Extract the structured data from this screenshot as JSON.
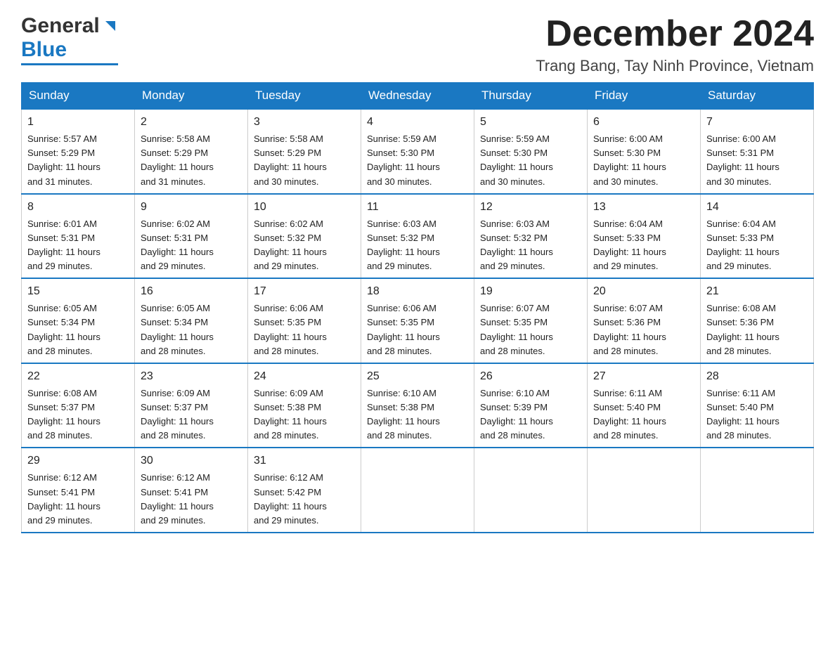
{
  "logo": {
    "general": "General",
    "blue": "Blue"
  },
  "title": "December 2024",
  "location": "Trang Bang, Tay Ninh Province, Vietnam",
  "days_of_week": [
    "Sunday",
    "Monday",
    "Tuesday",
    "Wednesday",
    "Thursday",
    "Friday",
    "Saturday"
  ],
  "weeks": [
    [
      {
        "day": "1",
        "sunrise": "5:57 AM",
        "sunset": "5:29 PM",
        "daylight": "11 hours and 31 minutes."
      },
      {
        "day": "2",
        "sunrise": "5:58 AM",
        "sunset": "5:29 PM",
        "daylight": "11 hours and 31 minutes."
      },
      {
        "day": "3",
        "sunrise": "5:58 AM",
        "sunset": "5:29 PM",
        "daylight": "11 hours and 30 minutes."
      },
      {
        "day": "4",
        "sunrise": "5:59 AM",
        "sunset": "5:30 PM",
        "daylight": "11 hours and 30 minutes."
      },
      {
        "day": "5",
        "sunrise": "5:59 AM",
        "sunset": "5:30 PM",
        "daylight": "11 hours and 30 minutes."
      },
      {
        "day": "6",
        "sunrise": "6:00 AM",
        "sunset": "5:30 PM",
        "daylight": "11 hours and 30 minutes."
      },
      {
        "day": "7",
        "sunrise": "6:00 AM",
        "sunset": "5:31 PM",
        "daylight": "11 hours and 30 minutes."
      }
    ],
    [
      {
        "day": "8",
        "sunrise": "6:01 AM",
        "sunset": "5:31 PM",
        "daylight": "11 hours and 29 minutes."
      },
      {
        "day": "9",
        "sunrise": "6:02 AM",
        "sunset": "5:31 PM",
        "daylight": "11 hours and 29 minutes."
      },
      {
        "day": "10",
        "sunrise": "6:02 AM",
        "sunset": "5:32 PM",
        "daylight": "11 hours and 29 minutes."
      },
      {
        "day": "11",
        "sunrise": "6:03 AM",
        "sunset": "5:32 PM",
        "daylight": "11 hours and 29 minutes."
      },
      {
        "day": "12",
        "sunrise": "6:03 AM",
        "sunset": "5:32 PM",
        "daylight": "11 hours and 29 minutes."
      },
      {
        "day": "13",
        "sunrise": "6:04 AM",
        "sunset": "5:33 PM",
        "daylight": "11 hours and 29 minutes."
      },
      {
        "day": "14",
        "sunrise": "6:04 AM",
        "sunset": "5:33 PM",
        "daylight": "11 hours and 29 minutes."
      }
    ],
    [
      {
        "day": "15",
        "sunrise": "6:05 AM",
        "sunset": "5:34 PM",
        "daylight": "11 hours and 28 minutes."
      },
      {
        "day": "16",
        "sunrise": "6:05 AM",
        "sunset": "5:34 PM",
        "daylight": "11 hours and 28 minutes."
      },
      {
        "day": "17",
        "sunrise": "6:06 AM",
        "sunset": "5:35 PM",
        "daylight": "11 hours and 28 minutes."
      },
      {
        "day": "18",
        "sunrise": "6:06 AM",
        "sunset": "5:35 PM",
        "daylight": "11 hours and 28 minutes."
      },
      {
        "day": "19",
        "sunrise": "6:07 AM",
        "sunset": "5:35 PM",
        "daylight": "11 hours and 28 minutes."
      },
      {
        "day": "20",
        "sunrise": "6:07 AM",
        "sunset": "5:36 PM",
        "daylight": "11 hours and 28 minutes."
      },
      {
        "day": "21",
        "sunrise": "6:08 AM",
        "sunset": "5:36 PM",
        "daylight": "11 hours and 28 minutes."
      }
    ],
    [
      {
        "day": "22",
        "sunrise": "6:08 AM",
        "sunset": "5:37 PM",
        "daylight": "11 hours and 28 minutes."
      },
      {
        "day": "23",
        "sunrise": "6:09 AM",
        "sunset": "5:37 PM",
        "daylight": "11 hours and 28 minutes."
      },
      {
        "day": "24",
        "sunrise": "6:09 AM",
        "sunset": "5:38 PM",
        "daylight": "11 hours and 28 minutes."
      },
      {
        "day": "25",
        "sunrise": "6:10 AM",
        "sunset": "5:38 PM",
        "daylight": "11 hours and 28 minutes."
      },
      {
        "day": "26",
        "sunrise": "6:10 AM",
        "sunset": "5:39 PM",
        "daylight": "11 hours and 28 minutes."
      },
      {
        "day": "27",
        "sunrise": "6:11 AM",
        "sunset": "5:40 PM",
        "daylight": "11 hours and 28 minutes."
      },
      {
        "day": "28",
        "sunrise": "6:11 AM",
        "sunset": "5:40 PM",
        "daylight": "11 hours and 28 minutes."
      }
    ],
    [
      {
        "day": "29",
        "sunrise": "6:12 AM",
        "sunset": "5:41 PM",
        "daylight": "11 hours and 29 minutes."
      },
      {
        "day": "30",
        "sunrise": "6:12 AM",
        "sunset": "5:41 PM",
        "daylight": "11 hours and 29 minutes."
      },
      {
        "day": "31",
        "sunrise": "6:12 AM",
        "sunset": "5:42 PM",
        "daylight": "11 hours and 29 minutes."
      },
      null,
      null,
      null,
      null
    ]
  ],
  "labels": {
    "sunrise": "Sunrise:",
    "sunset": "Sunset:",
    "daylight": "Daylight:"
  }
}
